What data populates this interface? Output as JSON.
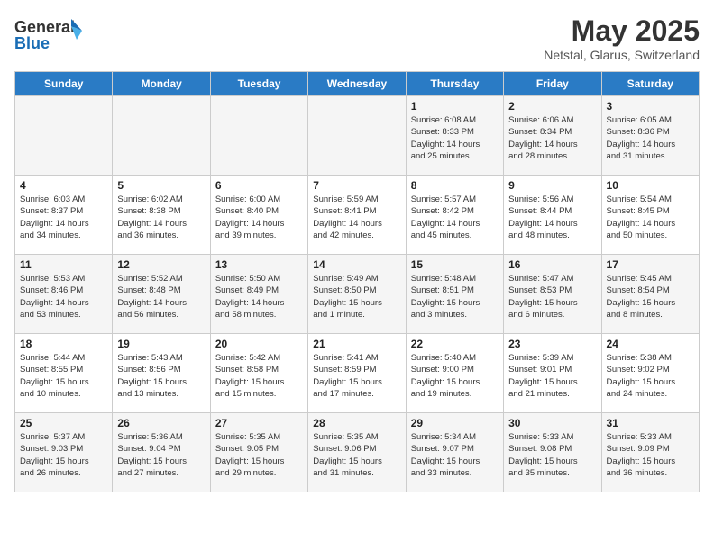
{
  "header": {
    "logo_line1": "General",
    "logo_line2": "Blue",
    "main_title": "May 2025",
    "subtitle": "Netstal, Glarus, Switzerland"
  },
  "days_of_week": [
    "Sunday",
    "Monday",
    "Tuesday",
    "Wednesday",
    "Thursday",
    "Friday",
    "Saturday"
  ],
  "weeks": [
    [
      {
        "day": "",
        "info": ""
      },
      {
        "day": "",
        "info": ""
      },
      {
        "day": "",
        "info": ""
      },
      {
        "day": "",
        "info": ""
      },
      {
        "day": "1",
        "info": "Sunrise: 6:08 AM\nSunset: 8:33 PM\nDaylight: 14 hours\nand 25 minutes."
      },
      {
        "day": "2",
        "info": "Sunrise: 6:06 AM\nSunset: 8:34 PM\nDaylight: 14 hours\nand 28 minutes."
      },
      {
        "day": "3",
        "info": "Sunrise: 6:05 AM\nSunset: 8:36 PM\nDaylight: 14 hours\nand 31 minutes."
      }
    ],
    [
      {
        "day": "4",
        "info": "Sunrise: 6:03 AM\nSunset: 8:37 PM\nDaylight: 14 hours\nand 34 minutes."
      },
      {
        "day": "5",
        "info": "Sunrise: 6:02 AM\nSunset: 8:38 PM\nDaylight: 14 hours\nand 36 minutes."
      },
      {
        "day": "6",
        "info": "Sunrise: 6:00 AM\nSunset: 8:40 PM\nDaylight: 14 hours\nand 39 minutes."
      },
      {
        "day": "7",
        "info": "Sunrise: 5:59 AM\nSunset: 8:41 PM\nDaylight: 14 hours\nand 42 minutes."
      },
      {
        "day": "8",
        "info": "Sunrise: 5:57 AM\nSunset: 8:42 PM\nDaylight: 14 hours\nand 45 minutes."
      },
      {
        "day": "9",
        "info": "Sunrise: 5:56 AM\nSunset: 8:44 PM\nDaylight: 14 hours\nand 48 minutes."
      },
      {
        "day": "10",
        "info": "Sunrise: 5:54 AM\nSunset: 8:45 PM\nDaylight: 14 hours\nand 50 minutes."
      }
    ],
    [
      {
        "day": "11",
        "info": "Sunrise: 5:53 AM\nSunset: 8:46 PM\nDaylight: 14 hours\nand 53 minutes."
      },
      {
        "day": "12",
        "info": "Sunrise: 5:52 AM\nSunset: 8:48 PM\nDaylight: 14 hours\nand 56 minutes."
      },
      {
        "day": "13",
        "info": "Sunrise: 5:50 AM\nSunset: 8:49 PM\nDaylight: 14 hours\nand 58 minutes."
      },
      {
        "day": "14",
        "info": "Sunrise: 5:49 AM\nSunset: 8:50 PM\nDaylight: 15 hours\nand 1 minute."
      },
      {
        "day": "15",
        "info": "Sunrise: 5:48 AM\nSunset: 8:51 PM\nDaylight: 15 hours\nand 3 minutes."
      },
      {
        "day": "16",
        "info": "Sunrise: 5:47 AM\nSunset: 8:53 PM\nDaylight: 15 hours\nand 6 minutes."
      },
      {
        "day": "17",
        "info": "Sunrise: 5:45 AM\nSunset: 8:54 PM\nDaylight: 15 hours\nand 8 minutes."
      }
    ],
    [
      {
        "day": "18",
        "info": "Sunrise: 5:44 AM\nSunset: 8:55 PM\nDaylight: 15 hours\nand 10 minutes."
      },
      {
        "day": "19",
        "info": "Sunrise: 5:43 AM\nSunset: 8:56 PM\nDaylight: 15 hours\nand 13 minutes."
      },
      {
        "day": "20",
        "info": "Sunrise: 5:42 AM\nSunset: 8:58 PM\nDaylight: 15 hours\nand 15 minutes."
      },
      {
        "day": "21",
        "info": "Sunrise: 5:41 AM\nSunset: 8:59 PM\nDaylight: 15 hours\nand 17 minutes."
      },
      {
        "day": "22",
        "info": "Sunrise: 5:40 AM\nSunset: 9:00 PM\nDaylight: 15 hours\nand 19 minutes."
      },
      {
        "day": "23",
        "info": "Sunrise: 5:39 AM\nSunset: 9:01 PM\nDaylight: 15 hours\nand 21 minutes."
      },
      {
        "day": "24",
        "info": "Sunrise: 5:38 AM\nSunset: 9:02 PM\nDaylight: 15 hours\nand 24 minutes."
      }
    ],
    [
      {
        "day": "25",
        "info": "Sunrise: 5:37 AM\nSunset: 9:03 PM\nDaylight: 15 hours\nand 26 minutes."
      },
      {
        "day": "26",
        "info": "Sunrise: 5:36 AM\nSunset: 9:04 PM\nDaylight: 15 hours\nand 27 minutes."
      },
      {
        "day": "27",
        "info": "Sunrise: 5:35 AM\nSunset: 9:05 PM\nDaylight: 15 hours\nand 29 minutes."
      },
      {
        "day": "28",
        "info": "Sunrise: 5:35 AM\nSunset: 9:06 PM\nDaylight: 15 hours\nand 31 minutes."
      },
      {
        "day": "29",
        "info": "Sunrise: 5:34 AM\nSunset: 9:07 PM\nDaylight: 15 hours\nand 33 minutes."
      },
      {
        "day": "30",
        "info": "Sunrise: 5:33 AM\nSunset: 9:08 PM\nDaylight: 15 hours\nand 35 minutes."
      },
      {
        "day": "31",
        "info": "Sunrise: 5:33 AM\nSunset: 9:09 PM\nDaylight: 15 hours\nand 36 minutes."
      }
    ]
  ]
}
